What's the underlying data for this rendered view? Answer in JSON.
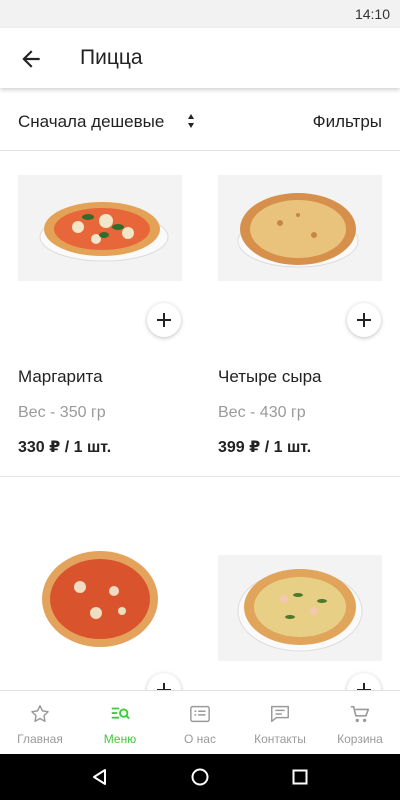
{
  "status_bar": {
    "time": "14:10"
  },
  "app_bar": {
    "title": "Пицца",
    "back_icon": "arrow-left-icon"
  },
  "sort_bar": {
    "sort_label": "Сначала дешевые",
    "filters_label": "Фильтры"
  },
  "products": [
    {
      "name": "Маргарита",
      "weight": "Вес - 350 гр",
      "price": "330 ₽ / 1 шт."
    },
    {
      "name": "Четыре сыра",
      "weight": "Вес - 430 гр",
      "price": "399 ₽ / 1 шт."
    },
    {
      "name": "",
      "weight": "",
      "price": ""
    },
    {
      "name": "",
      "weight": "",
      "price": ""
    }
  ],
  "bottom_nav": {
    "items": [
      {
        "label": "Главная",
        "icon": "star-icon",
        "active": false
      },
      {
        "label": "Меню",
        "icon": "menu-search-icon",
        "active": true
      },
      {
        "label": "О нас",
        "icon": "list-card-icon",
        "active": false
      },
      {
        "label": "Контакты",
        "icon": "chat-icon",
        "active": false
      },
      {
        "label": "Корзина",
        "icon": "cart-icon",
        "active": false
      }
    ]
  },
  "colors": {
    "accent": "#3ec93e",
    "muted": "#9a9a9a",
    "text": "#222222"
  }
}
